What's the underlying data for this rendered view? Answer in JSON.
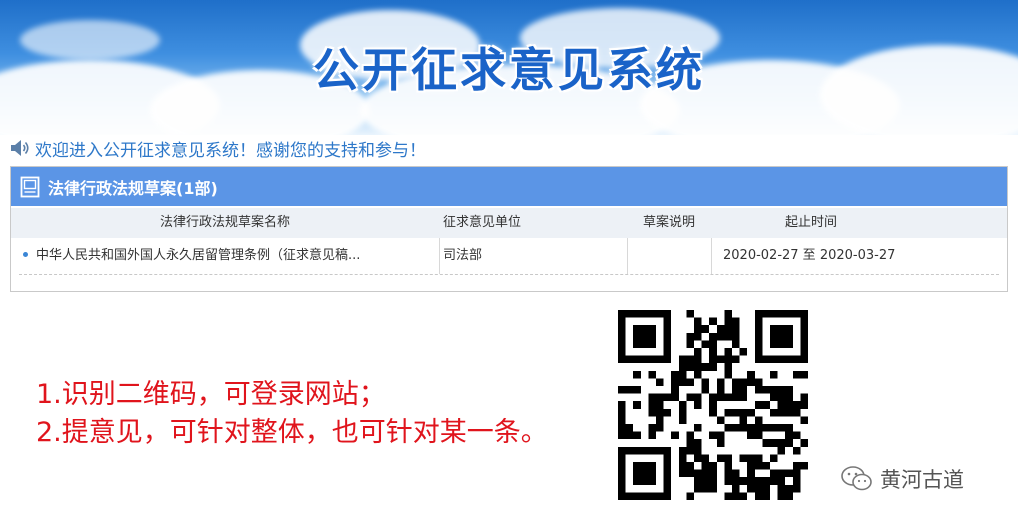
{
  "banner": {
    "title": "公开征求意见系统"
  },
  "welcome": {
    "text": "欢迎进入公开征求意见系统！感谢您的支持和参与！",
    "icon": "speaker-icon"
  },
  "panel": {
    "title": "法律行政法规草案(1部)",
    "icon": "document-icon",
    "columns": [
      "法律行政法规草案名称",
      "征求意见单位",
      "草案说明",
      "起止时间"
    ],
    "rows": [
      {
        "name": "中华人民共和国外国人永久居留管理条例（征求意见稿...",
        "unit": "司法部",
        "note": "",
        "period": "2020-02-27 至 2020-03-27"
      }
    ]
  },
  "instructions": {
    "line1": "1.识别二维码，可登录网站；",
    "line2": "2.提意见，可针对整体，也可针对某一条。"
  },
  "watermark": {
    "text": "黄河古道",
    "icon": "wechat-icon"
  },
  "colors": {
    "accent": "#5b95e6",
    "title_blue": "#1a63c8",
    "welcome_blue": "#2e78c9",
    "instruction_red": "#e0141c"
  }
}
